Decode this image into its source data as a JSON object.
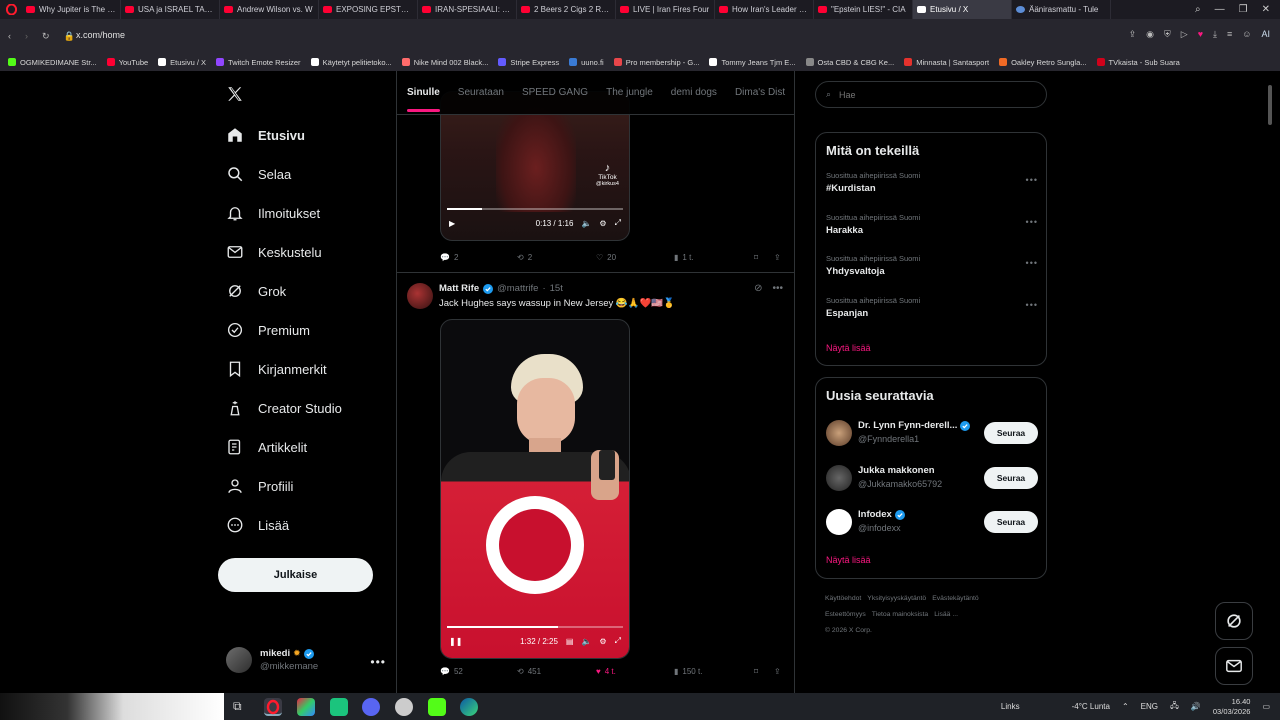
{
  "browser": {
    "tabs": [
      {
        "title": "Why Jupiter is The Sc"
      },
      {
        "title": "USA ja ISRAEL TAPPO"
      },
      {
        "title": "Andrew Wilson vs. W"
      },
      {
        "title": "EXPOSING EPSTEIN'S"
      },
      {
        "title": "IRAN-SPESIAALI: Trum"
      },
      {
        "title": "2 Beers 2 Cigs 2 Rubik"
      },
      {
        "title": "LIVE | Iran Fires Four"
      },
      {
        "title": "How Iran's Leader Wa"
      },
      {
        "title": "\"Epstein LIES!\" - CIA"
      },
      {
        "title": "Etusivu / X"
      },
      {
        "title": "Äänirasmattu - Tule"
      }
    ],
    "active_tab": "Etusivu / X",
    "url": "x.com/home",
    "ai_label": "AI",
    "bookmarks": [
      {
        "label": "OGMIKEDIMANE Str...",
        "color": "#53fc18"
      },
      {
        "label": "YouTube",
        "color": "#ff0033"
      },
      {
        "label": "Etusivu / X",
        "color": "#ffffff"
      },
      {
        "label": "Twitch Emote Resizer",
        "color": "#9146ff"
      },
      {
        "label": "Käytetyt pelitietoko...",
        "color": "#ffffff"
      },
      {
        "label": "Nike Mind 002 Black...",
        "color": "#ff6b6b"
      },
      {
        "label": "Stripe Express",
        "color": "#635bff"
      },
      {
        "label": "uuno.fi",
        "color": "#3a7bd5"
      },
      {
        "label": "Pro membership - G...",
        "color": "#e8464a"
      },
      {
        "label": "Tommy Jeans Tjm E...",
        "color": "#ffffff"
      },
      {
        "label": "Osta CBD & CBG Ke...",
        "color": "#888888"
      },
      {
        "label": "Minnasta | Santasport",
        "color": "#e5322d"
      },
      {
        "label": "Oakley Retro Sungla...",
        "color": "#f06a25"
      },
      {
        "label": "TVkaista - Sub Suara",
        "color": "#d0021b"
      }
    ]
  },
  "nav": {
    "items": [
      {
        "label": "Etusivu",
        "icon": "home-icon"
      },
      {
        "label": "Selaa",
        "icon": "search-icon"
      },
      {
        "label": "Ilmoitukset",
        "icon": "bell-icon"
      },
      {
        "label": "Keskustelu",
        "icon": "mail-icon"
      },
      {
        "label": "Grok",
        "icon": "grok-icon"
      },
      {
        "label": "Premium",
        "icon": "premium-icon"
      },
      {
        "label": "Kirjanmerkit",
        "icon": "bookmark-icon"
      },
      {
        "label": "Creator Studio",
        "icon": "creator-icon"
      },
      {
        "label": "Artikkelit",
        "icon": "article-icon"
      },
      {
        "label": "Profiili",
        "icon": "profile-icon"
      },
      {
        "label": "Lisää",
        "icon": "more-icon"
      }
    ],
    "post_button": "Julkaise",
    "account": {
      "name": "mikedi",
      "handle": "@mikkemane"
    }
  },
  "feed": {
    "tabs": [
      "Sinulle",
      "Seurataan",
      "SPEED GANG",
      "The jungle",
      "demi dogs",
      "Dima's Dist"
    ],
    "post1": {
      "tiktok_label": "TikTok",
      "tiktok_user": "@kirkus4",
      "video_time": "0:13 / 1:16",
      "progress": 0.2,
      "replies": "2",
      "reposts": "2",
      "likes": "20",
      "views": "1 t."
    },
    "post2": {
      "author": "Matt Rife",
      "handle": "@mattrife",
      "age": "15t",
      "text": "Jack Hughes says wassup in New Jersey 😂🙏❤️🇺🇸🥇",
      "video_time": "1:32 / 2:25",
      "progress": 0.63,
      "replies": "52",
      "reposts": "451",
      "likes": "4 t.",
      "views": "150 t."
    }
  },
  "sidebar": {
    "search_placeholder": "Hae",
    "trending_title": "Mitä on tekeillä",
    "trends": [
      {
        "context": "Suosittua aihepiirissä Suomi",
        "name": "#Kurdistan"
      },
      {
        "context": "Suosittua aihepiirissä Suomi",
        "name": "Harakka"
      },
      {
        "context": "Suosittua aihepiirissä Suomi",
        "name": "Yhdysvaltoja"
      },
      {
        "context": "Suosittua aihepiirissä Suomi",
        "name": "Espanjan"
      }
    ],
    "show_more": "Näytä lisää",
    "who_title": "Uusia seurattavia",
    "who": [
      {
        "name": "Dr. Lynn Fynn-derell...",
        "handle": "@Fynnderella1",
        "verified": true
      },
      {
        "name": "Jukka makkonen",
        "handle": "@Jukkamakko65792",
        "verified": false
      },
      {
        "name": "Infodex",
        "handle": "@infodexx",
        "verified": true
      }
    ],
    "follow_label": "Seuraa",
    "footer": [
      "Käyttöehdot",
      "Yksityisyyskäytäntö",
      "Evästekäytäntö",
      "Esteettömyys",
      "Tietoa mainoksista",
      "Lisää ...",
      "© 2026 X Corp."
    ]
  },
  "taskbar": {
    "links_label": "Links",
    "weather": "-4°C  Lunta",
    "lang": "ENG",
    "time": "16.40",
    "date": "03/03/2026"
  },
  "colors": {
    "accent": "#f91880",
    "verified": "#1d9bf0",
    "bg": "#000000",
    "border": "#2f3336"
  }
}
